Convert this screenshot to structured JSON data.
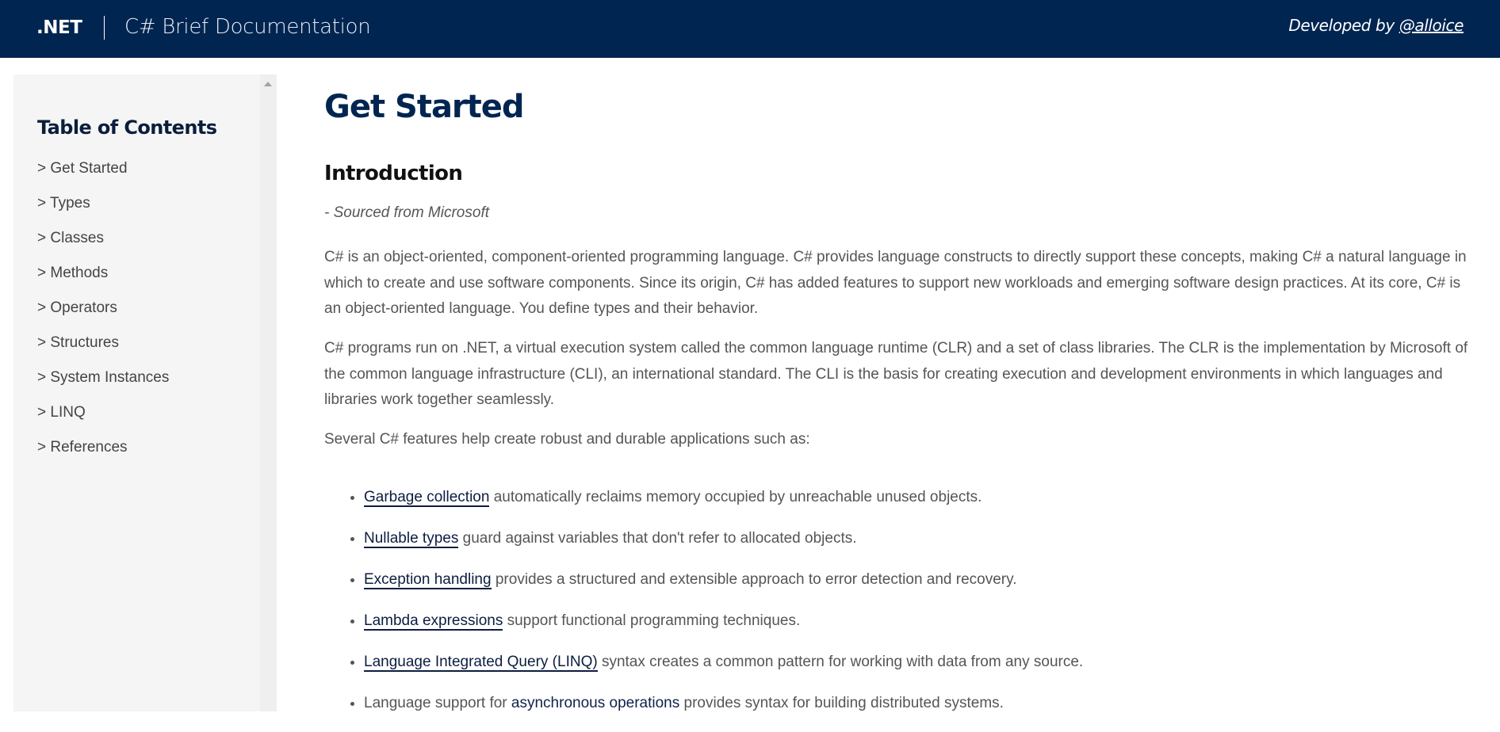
{
  "header": {
    "logo": ".NET",
    "title": "C# Brief Documentation",
    "developed_by": "Developed by",
    "author_link": "@alloice"
  },
  "sidebar": {
    "title": "Table of Contents",
    "items": [
      {
        "label": "> Get Started"
      },
      {
        "label": "> Types"
      },
      {
        "label": "> Classes"
      },
      {
        "label": "> Methods"
      },
      {
        "label": "> Operators"
      },
      {
        "label": "> Structures"
      },
      {
        "label": "> System Instances"
      },
      {
        "label": "> LINQ"
      },
      {
        "label": "> References"
      }
    ]
  },
  "main": {
    "title": "Get Started",
    "section_title": "Introduction",
    "source": "- Sourced from Microsoft",
    "paragraphs": [
      "C# is an object-oriented, component-oriented programming language. C# provides language constructs to directly support these concepts, making C# a natural language in which to create and use software components. Since its origin, C# has added features to support new workloads and emerging software design practices. At its core, C# is an object-oriented language. You define types and their behavior.",
      "C# programs run on .NET, a virtual execution system called the common language runtime (CLR) and a set of class libraries. The CLR is the implementation by Microsoft of the common language infrastructure (CLI), an international standard. The CLI is the basis for creating execution and development environments in which languages and libraries work together seamlessly.",
      "Several C# features help create robust and durable applications such as:"
    ],
    "features": [
      {
        "prefix": "",
        "link": "Garbage collection",
        "text": " automatically reclaims memory occupied by unreachable unused objects."
      },
      {
        "prefix": "",
        "link": "Nullable types",
        "text": " guard against variables that don't refer to allocated objects."
      },
      {
        "prefix": "",
        "link": "Exception handling",
        "text": " provides a structured and extensible approach to error detection and recovery."
      },
      {
        "prefix": "",
        "link": "Lambda expressions",
        "text": " support functional programming techniques."
      },
      {
        "prefix": "",
        "link": "Language Integrated Query (LINQ)",
        "text": " syntax creates a common pattern for working with data from any source."
      },
      {
        "prefix": "Language support for ",
        "link": "asynchronous operations",
        "text": " provides syntax for building distributed systems."
      }
    ]
  }
}
